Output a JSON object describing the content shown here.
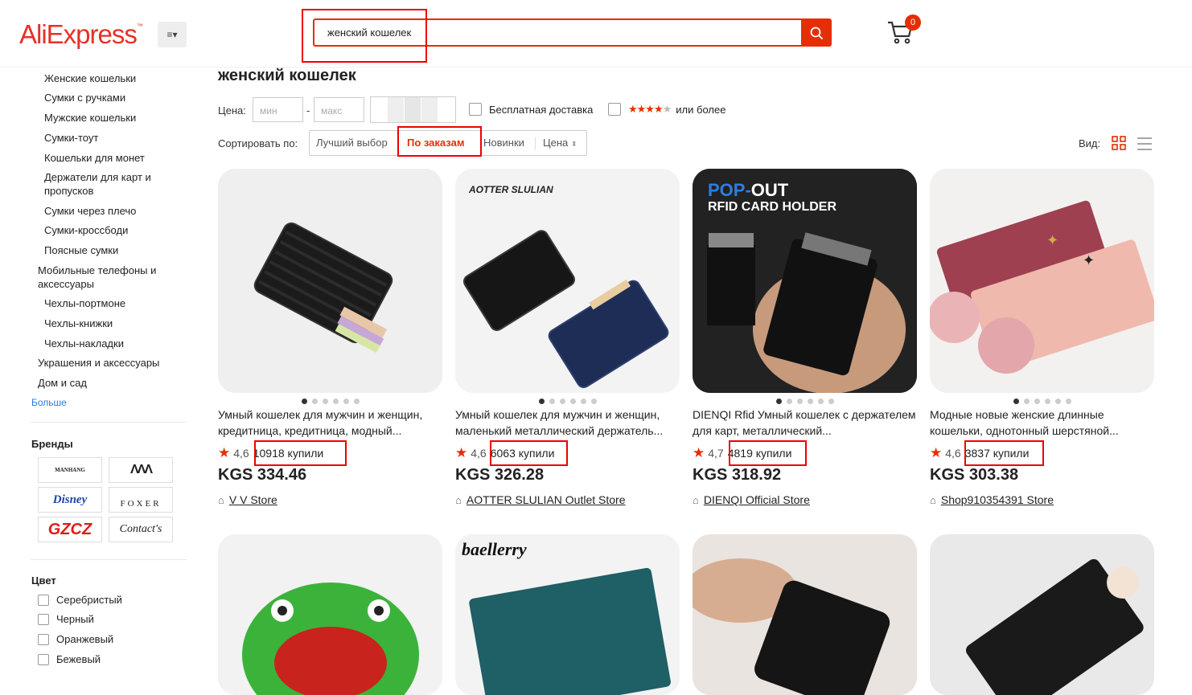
{
  "header": {
    "logo": "AliExpress",
    "logo_tm": "™",
    "menu_glyph": "≡▾",
    "search_value": "женский кошелек",
    "cart_count": "0",
    "accent": "#e62e04"
  },
  "sidebar": {
    "categories": [
      "Женские кошельки",
      "Сумки с ручками",
      "Мужские кошельки",
      "Сумки-тоут",
      "Кошельки для монет",
      "Держатели для карт и пропусков",
      "Сумки через плечо",
      "Сумки-кроссбоди",
      "Поясные сумки",
      "Мобильные телефоны и аксессуары",
      "Чехлы-портмоне",
      "Чехлы-книжки",
      "Чехлы-накладки",
      "Украшения и аксессуары",
      "Дом и сад"
    ],
    "more": "Больше",
    "brands_title": "Бренды",
    "brands": [
      "MANHANG",
      "ΛΛΛ",
      "Disney",
      "FOXER",
      "GZCZ",
      "Contact's"
    ],
    "color_title": "Цвет",
    "colors": [
      "Серебристый",
      "Черный",
      "Оранжевый",
      "Бежевый"
    ]
  },
  "main": {
    "title": "женский кошелек",
    "price_label": "Цена:",
    "price_min": "мин",
    "price_dash": "-",
    "price_max": "макс",
    "free_shipping": "Бесплатная доставка",
    "stars_glyph": "★★★★★",
    "rating_more": "или более",
    "sort_label": "Сортировать по:",
    "sort_options": [
      "Лучший выбор",
      "По заказам",
      "Новинки",
      "Цена"
    ],
    "sort_active": "По заказам",
    "view_label": "Вид:"
  },
  "products": [
    {
      "title": "Умный кошелек для мужчин и женщин, кредитница, кредитница, модный...",
      "rating": "4,6",
      "sold": "10918 купили",
      "price": "KGS 334.46",
      "store": "V V Store"
    },
    {
      "title": "Умный кошелек для мужчин и женщин, маленький металлический держатель...",
      "rating": "4,6",
      "sold": "6063 купили",
      "price": "KGS 326.28",
      "store": "AOTTER SLULIAN Outlet Store",
      "image_text": "AOTTER SLULIAN"
    },
    {
      "title": "DIENQI Rfid Умный кошелек с держателем для карт, металлический...",
      "rating": "4,7",
      "sold": "4819 купили",
      "price": "KGS 318.92",
      "store": "DIENQI Official Store",
      "image_text_1": "POP-",
      "image_text_2": "OUT",
      "image_text_3": "RFID CARD HOLDER"
    },
    {
      "title": "Модные новые женские длинные кошельки, однотонный шерстяной...",
      "rating": "4,6",
      "sold": "3837 купили",
      "price": "KGS 303.38",
      "store": "Shop910354391 Store"
    }
  ],
  "row2_image_text": "baellerry"
}
